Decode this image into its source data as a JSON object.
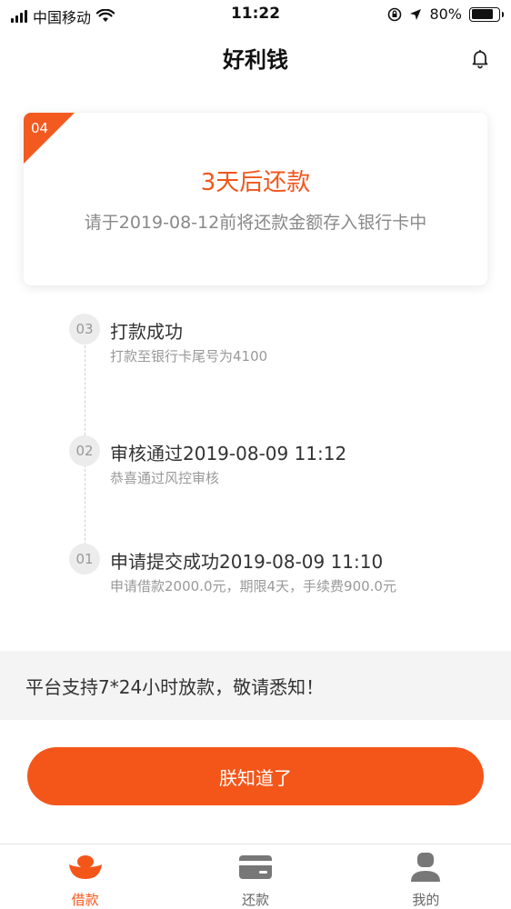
{
  "status_bar": {
    "carrier": "中国移动",
    "time": "11:22",
    "battery": "80%",
    "battery_level": 0.8
  },
  "nav": {
    "title": "好利钱",
    "bell_icon": "bell-icon"
  },
  "card": {
    "step_number": "04",
    "title": "3天后还款",
    "description": "请于2019-08-12前将还款金额存入银行卡中",
    "accent_color": "#f25a1f"
  },
  "timeline": {
    "steps": [
      {
        "number": "03",
        "title": "打款成功",
        "subtitle": "打款至银行卡尾号为4100"
      },
      {
        "number": "02",
        "title": "审核通过2019-08-09 11:12",
        "subtitle": "恭喜通过风控审核"
      },
      {
        "number": "01",
        "title": "申请提交成功2019-08-09 11:10",
        "subtitle": "申请借款2000.0元，期限4天，手续费900.0元"
      }
    ]
  },
  "notice": {
    "text": "平台支持7*24小时放款，敬请悉知！"
  },
  "button": {
    "label": "朕知道了",
    "color": "#f4561a"
  },
  "tab_bar": {
    "tabs": [
      {
        "label": "借款",
        "icon": "ingot-icon",
        "active": true
      },
      {
        "label": "还款",
        "icon": "card-icon",
        "active": false
      },
      {
        "label": "我的",
        "icon": "user-icon",
        "active": false
      }
    ]
  }
}
